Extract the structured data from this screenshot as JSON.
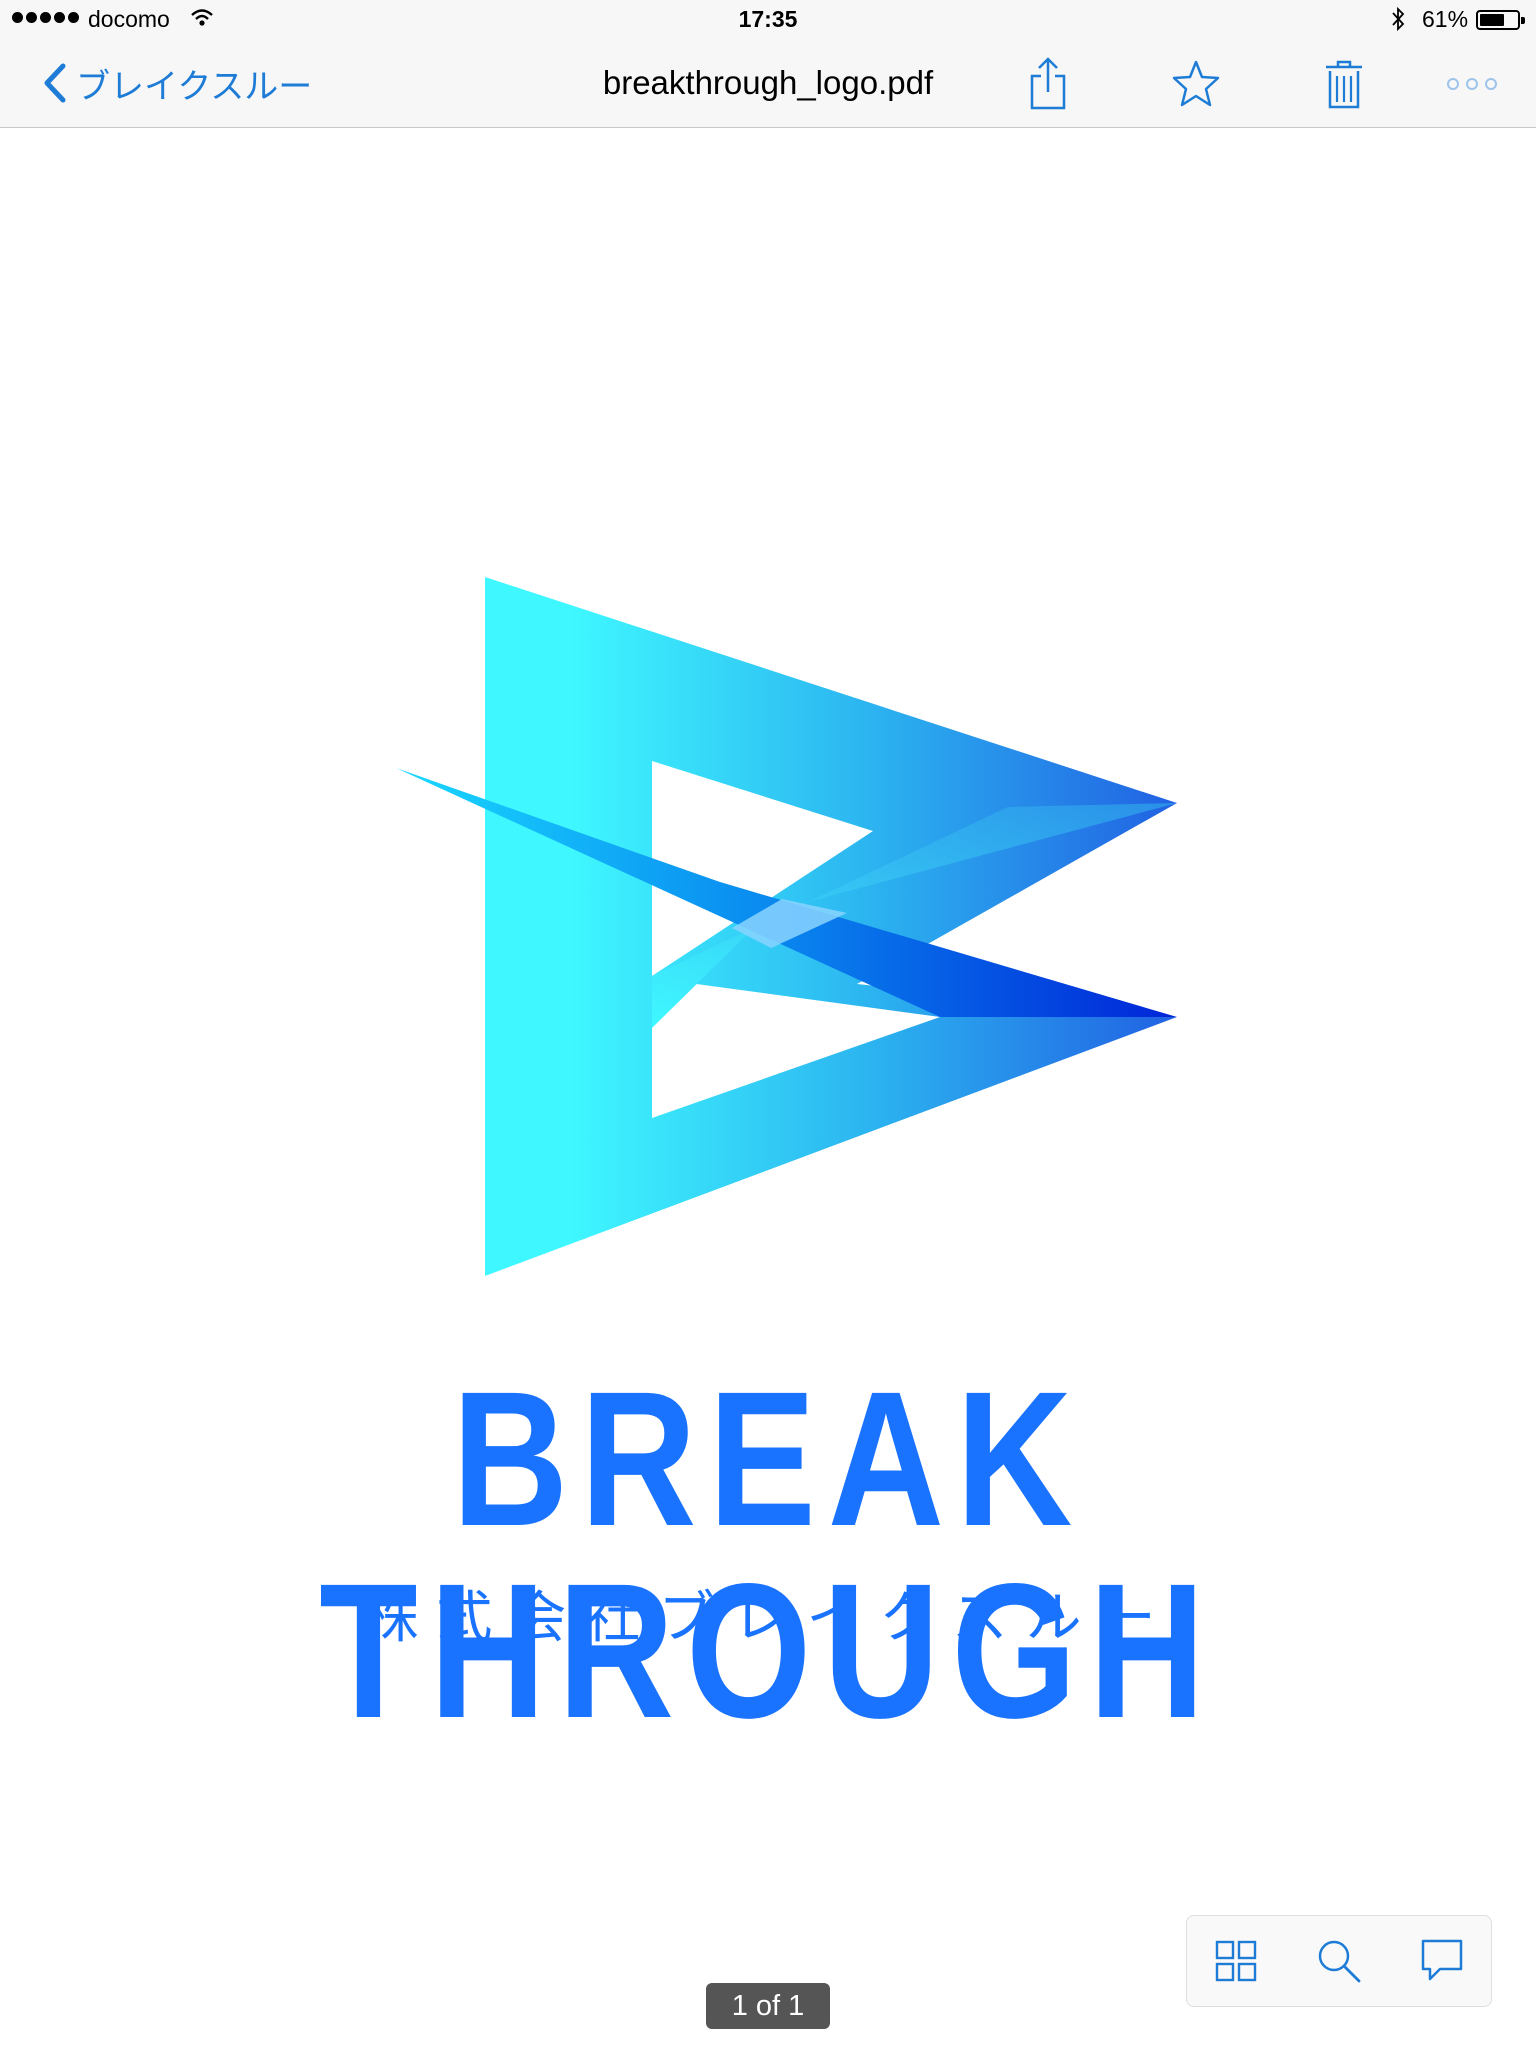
{
  "status_bar": {
    "carrier": "docomo",
    "time": "17:35",
    "battery": "61%"
  },
  "nav": {
    "back_label": "ブレイクスルー",
    "title": "breakthrough_logo.pdf",
    "icons": [
      "share-icon",
      "star-icon",
      "trash-icon",
      "more-icon"
    ]
  },
  "document": {
    "brand_name": "BREAK THROUGH",
    "company_name": "株式会社ブレイクスルー"
  },
  "toolbar": {
    "icons": [
      "thumbnail-grid-icon",
      "search-icon",
      "comment-icon"
    ]
  },
  "page_indicator": "1 of 1",
  "colors": {
    "accent": "#1e7cd6",
    "brand_blue": "#1a73ff",
    "logo_light": "#3ff8ff",
    "logo_dark": "#0025d8"
  }
}
